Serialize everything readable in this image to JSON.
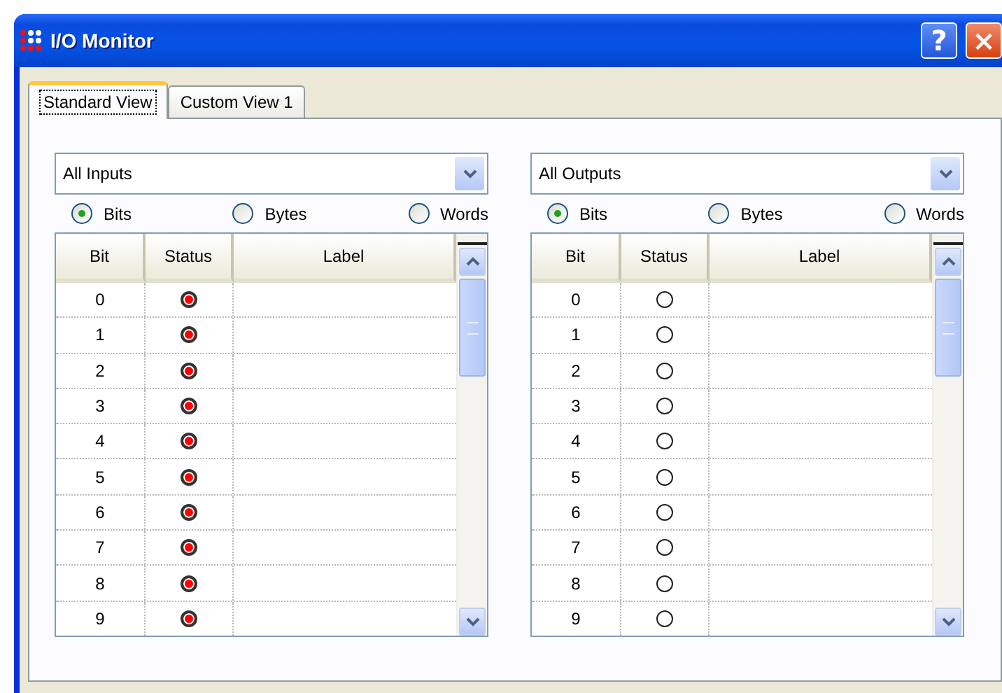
{
  "window": {
    "title": "I/O Monitor",
    "buttons": [
      "?",
      "×"
    ]
  },
  "tabs": [
    {
      "label": "Standard View",
      "selected": true
    },
    {
      "label": "Custom View 1",
      "selected": false
    }
  ],
  "panels": [
    {
      "dropdown": "All Inputs",
      "radios": [
        {
          "label": "Bits",
          "selected": true
        },
        {
          "label": "Bytes",
          "selected": false
        },
        {
          "label": "Words",
          "selected": false
        }
      ],
      "columns": [
        "Bit",
        "Status",
        "Label"
      ],
      "rows": [
        {
          "bit": "0",
          "on": true
        },
        {
          "bit": "1",
          "on": true
        },
        {
          "bit": "2",
          "on": true
        },
        {
          "bit": "3",
          "on": true
        },
        {
          "bit": "4",
          "on": true
        },
        {
          "bit": "5",
          "on": true
        },
        {
          "bit": "6",
          "on": true
        },
        {
          "bit": "7",
          "on": true
        },
        {
          "bit": "8",
          "on": true
        },
        {
          "bit": "9",
          "on": true
        }
      ]
    },
    {
      "dropdown": "All Outputs",
      "radios": [
        {
          "label": "Bits",
          "selected": true
        },
        {
          "label": "Bytes",
          "selected": false
        },
        {
          "label": "Words",
          "selected": false
        }
      ],
      "columns": [
        "Bit",
        "Status",
        "Label"
      ],
      "rows": [
        {
          "bit": "0",
          "on": false
        },
        {
          "bit": "1",
          "on": false
        },
        {
          "bit": "2",
          "on": false
        },
        {
          "bit": "3",
          "on": false
        },
        {
          "bit": "4",
          "on": false
        },
        {
          "bit": "5",
          "on": false
        },
        {
          "bit": "6",
          "on": false
        },
        {
          "bit": "7",
          "on": false
        },
        {
          "bit": "8",
          "on": false
        },
        {
          "bit": "9",
          "on": false
        }
      ]
    }
  ]
}
